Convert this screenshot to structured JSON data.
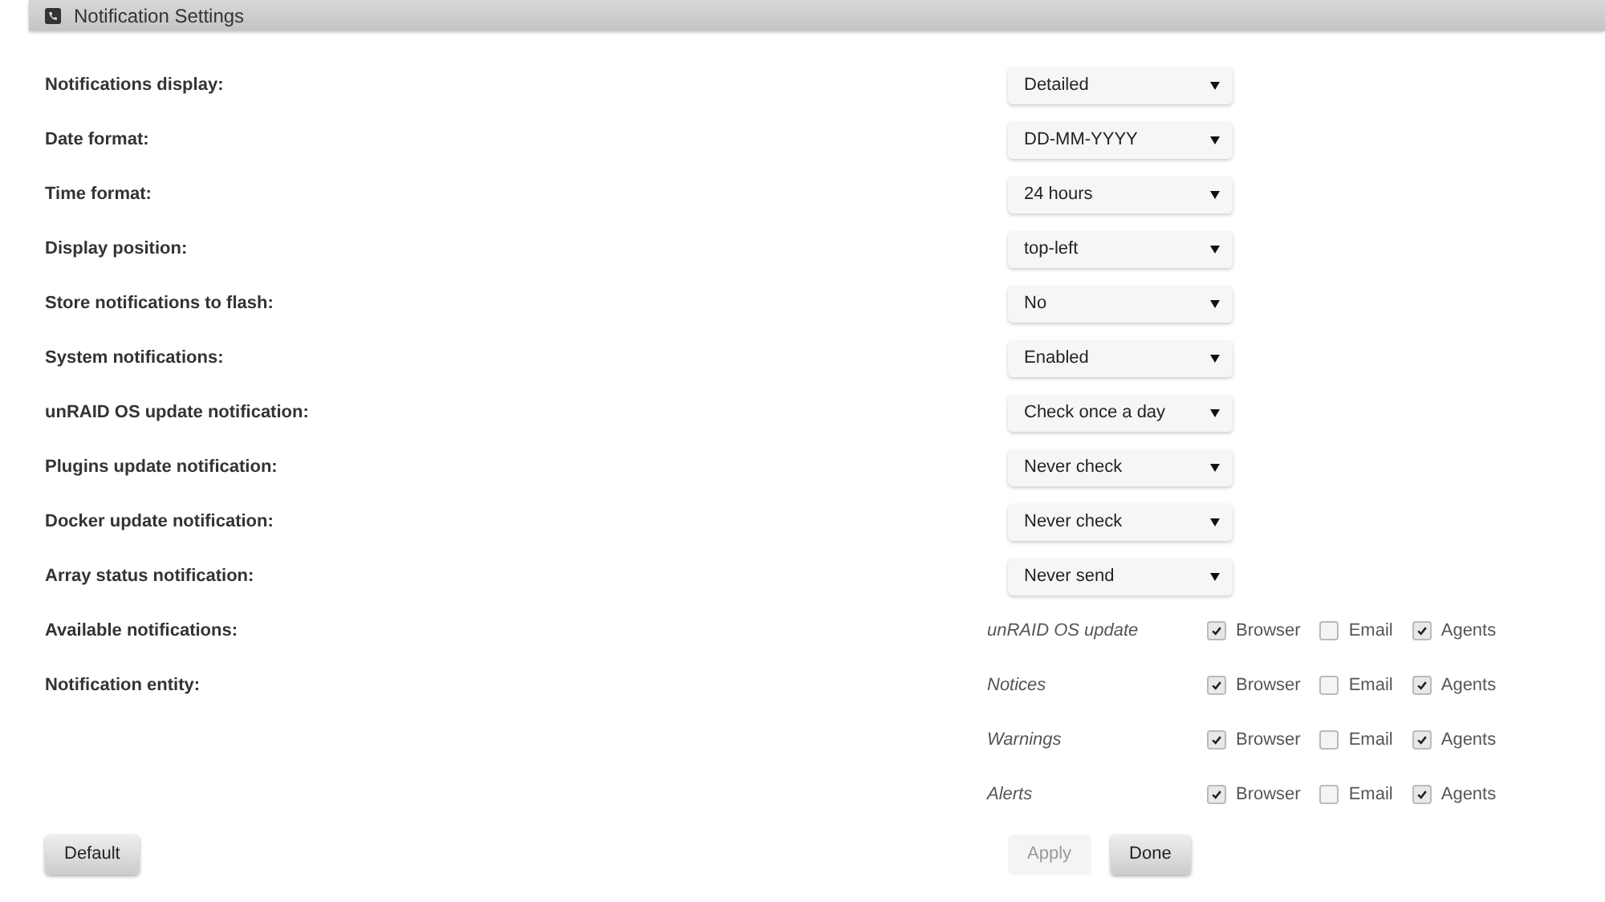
{
  "panel": {
    "title": "Notification Settings"
  },
  "settings": [
    {
      "label": "Notifications display:",
      "value": "Detailed"
    },
    {
      "label": "Date format:",
      "value": "DD-MM-YYYY"
    },
    {
      "label": "Time format:",
      "value": "24 hours"
    },
    {
      "label": "Display position:",
      "value": "top-left"
    },
    {
      "label": "Store notifications to flash:",
      "value": "No"
    },
    {
      "label": "System notifications:",
      "value": "Enabled"
    },
    {
      "label": "unRAID OS update notification:",
      "value": "Check once a day"
    },
    {
      "label": "Plugins update notification:",
      "value": "Never check"
    },
    {
      "label": "Docker update notification:",
      "value": "Never check"
    },
    {
      "label": "Array status notification:",
      "value": "Never send"
    }
  ],
  "entity_labels": [
    "Available notifications:",
    "Notification entity:"
  ],
  "entities": [
    {
      "name": "unRAID OS update",
      "channels": [
        {
          "label": "Browser",
          "checked": true
        },
        {
          "label": "Email",
          "checked": false
        },
        {
          "label": "Agents",
          "checked": true
        }
      ]
    },
    {
      "name": "Notices",
      "channels": [
        {
          "label": "Browser",
          "checked": true
        },
        {
          "label": "Email",
          "checked": false
        },
        {
          "label": "Agents",
          "checked": true
        }
      ]
    },
    {
      "name": "Warnings",
      "channels": [
        {
          "label": "Browser",
          "checked": true
        },
        {
          "label": "Email",
          "checked": false
        },
        {
          "label": "Agents",
          "checked": true
        }
      ]
    },
    {
      "name": "Alerts",
      "channels": [
        {
          "label": "Browser",
          "checked": true
        },
        {
          "label": "Email",
          "checked": false
        },
        {
          "label": "Agents",
          "checked": true
        }
      ]
    }
  ],
  "buttons": {
    "default": {
      "label": "Default"
    },
    "apply": {
      "label": "Apply",
      "disabled": true
    },
    "done": {
      "label": "Done",
      "disabled": false
    }
  }
}
